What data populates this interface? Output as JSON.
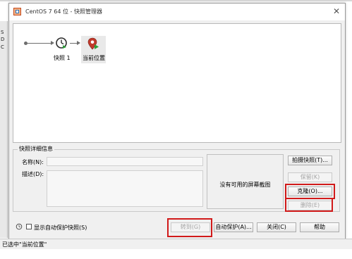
{
  "window": {
    "title": "CentOS 7 64 位 - 快照管理器",
    "close_glyph": "✕"
  },
  "background": {
    "fragments": [
      "S",
      "D",
      "C"
    ]
  },
  "tree": {
    "snapshot_label": "快照 1",
    "current_label": "当前位置"
  },
  "details": {
    "group_title": "快照详细信息",
    "name_label": "名称(N):",
    "desc_label": "描述(D):",
    "name_value": "",
    "desc_value": "",
    "preview_text": "没有可用的屏幕截图"
  },
  "buttons": {
    "take_snapshot": "拍摄快照(T)...",
    "keep": "保留(K)",
    "clone": "克隆(O)...",
    "delete": "删除(E)",
    "goto": "转到(G)",
    "autoprotect": "自动保护(A)...",
    "close": "关闭(C)",
    "help": "帮助"
  },
  "options": {
    "show_autoprotect": "显示自动保护快照(S)",
    "show_autoprotect_checked": false
  },
  "status": {
    "text": "已选中\"当前位置\""
  },
  "colors": {
    "highlight_box": "#d11a1a",
    "clock_icon": "#2b2b2b",
    "pin_icon": "#c0392b",
    "pin_arrow": "#2e9e3a"
  }
}
